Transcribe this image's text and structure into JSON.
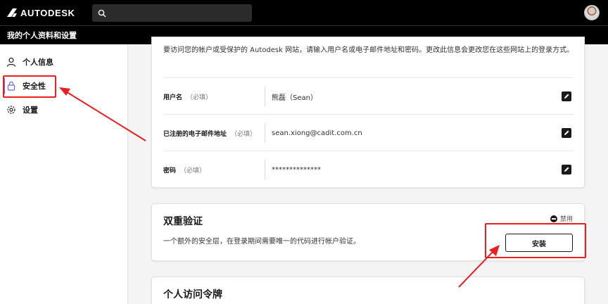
{
  "brand": {
    "name": "AUTODESK"
  },
  "search": {
    "placeholder": ""
  },
  "subheader": {
    "title": "我的个人资料和设置"
  },
  "sidebar": {
    "items": [
      {
        "label": "个人信息",
        "icon": "person-icon"
      },
      {
        "label": "安全性",
        "icon": "lock-icon",
        "active": true
      },
      {
        "label": "设置",
        "icon": "gear-icon"
      }
    ]
  },
  "security": {
    "intro": "要访问您的帐户或受保护的 Autodesk 网站，请输入用户名或电子邮件地址和密码。更改此信息会更改您在这些网站上的登录方式。",
    "rows": [
      {
        "label": "用户名",
        "required": "（必填）",
        "value": "熊磊（Sean）"
      },
      {
        "label": "已注册的电子邮件地址",
        "required": "（必填）",
        "value": "sean.xiong@cadit.com.cn"
      },
      {
        "label": "密码",
        "required": "（必填）",
        "value": "**************"
      }
    ]
  },
  "two_factor": {
    "title": "双重验证",
    "status": "禁用",
    "description": "一个额外的安全层，在登录期间需要唯一的代码进行帐户验证。",
    "button_label": "安装"
  },
  "access_token": {
    "title": "个人访问令牌"
  },
  "colors": {
    "annotation": "#e8201f",
    "active_bar": "#6b66ff",
    "nav_bg": "#000000"
  }
}
